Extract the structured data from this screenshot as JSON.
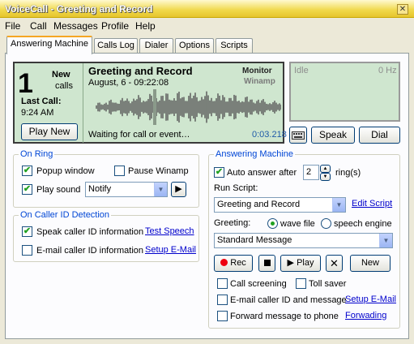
{
  "window": {
    "title": "VoiceCall - Greeting and Record",
    "close_glyph": "✕"
  },
  "menu": [
    "File",
    "Call",
    "Messages",
    "Profile",
    "Help"
  ],
  "tabs": [
    "Answering Machine",
    "Calls Log",
    "Dialer",
    "Options",
    "Scripts"
  ],
  "status": {
    "calls_count": "1",
    "new_label": "New",
    "calls_label": "calls",
    "last_call_label": "Last Call:",
    "last_call_time": "9:24 AM",
    "play_new": "Play New",
    "greeting_title": "Greeting and Record",
    "greeting_date": "August, 6 - 09:22:08",
    "monitor": "Monitor",
    "winamp": "Winamp",
    "waiting": "Waiting for call or event…",
    "timer": "0:03.218"
  },
  "freq": {
    "idle": "Idle",
    "hz": "0 Hz"
  },
  "actions": {
    "speak": "Speak",
    "dial": "Dial",
    "keyboard_icon": "keyboard-icon"
  },
  "on_ring": {
    "legend": "On Ring",
    "popup": "Popup window",
    "pause_winamp": "Pause Winamp",
    "play_sound": "Play sound",
    "sound_value": "Notify"
  },
  "caller_id": {
    "legend": "On Caller ID Detection",
    "speak": "Speak caller ID information",
    "test_speech": "Test Speech",
    "email": "E-mail caller ID information",
    "setup_email": "Setup E-Mail"
  },
  "answering": {
    "legend": "Answering Machine",
    "auto_answer": "Auto answer after",
    "rings_value": "2",
    "rings_label": "ring(s)",
    "run_script": "Run Script:",
    "script_value": "Greeting and Record",
    "edit_script": "Edit Script",
    "greeting_label": "Greeting:",
    "wave_file": "wave file",
    "speech_engine": "speech engine",
    "message_value": "Standard Message",
    "rec": "Rec",
    "play": "Play",
    "new": "New",
    "call_screening": "Call screening",
    "toll_saver": "Toll saver",
    "email_caller": "E-mail caller ID and message",
    "setup_email": "Setup E-Mail",
    "forward": "Forward message to phone",
    "forwarding": "Forwading"
  }
}
